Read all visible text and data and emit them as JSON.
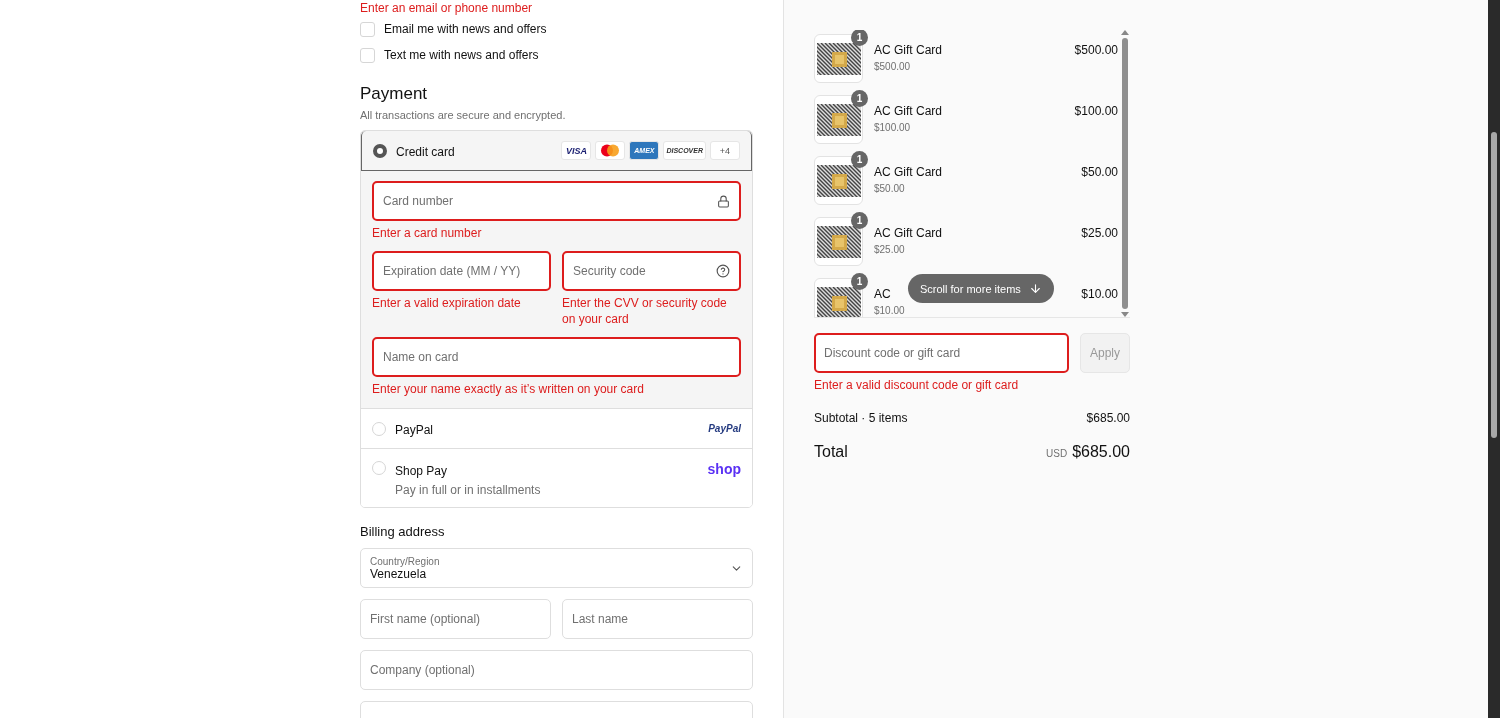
{
  "contact_error": "Enter an email or phone number",
  "marketing": [
    {
      "label": "Email me with news and offers",
      "checked": false
    },
    {
      "label": "Text me with news and offers",
      "checked": false
    }
  ],
  "payment": {
    "title": "Payment",
    "subtitle": "All transactions are secure and encrypted.",
    "methods": [
      {
        "kind": "card",
        "label": "Credit card",
        "selected": true,
        "brands": [
          {
            "kind": "visa",
            "label": "VISA"
          },
          {
            "kind": "mastercard"
          },
          {
            "kind": "amex",
            "label": "AMEX"
          },
          {
            "kind": "discover",
            "label": "DISCOVER"
          },
          {
            "kind": "more",
            "label": "+4"
          }
        ],
        "fields": [
          {
            "kind": "number",
            "placeholder": "Card number",
            "error": "Enter a card number"
          },
          {
            "kind": "expiry",
            "placeholder": "Expiration date (MM / YY)",
            "error": "Enter a valid expiration date"
          },
          {
            "kind": "cvv",
            "placeholder": "Security code",
            "error": "Enter the CVV or security code on your card"
          },
          {
            "kind": "name",
            "placeholder": "Name on card",
            "error": "Enter your name exactly as it’s written on your card"
          }
        ]
      },
      {
        "kind": "paypal",
        "label": "PayPal",
        "selected": false,
        "logo": "PayPal"
      },
      {
        "kind": "shoppay",
        "label": "Shop Pay",
        "selected": false,
        "logo": "shop",
        "note": "Pay in full or in installments"
      }
    ]
  },
  "billing": {
    "title": "Billing address",
    "country_label": "Country/Region",
    "country": "Venezuela",
    "fields": [
      {
        "placeholder": "First name (optional)"
      },
      {
        "placeholder": "Last name"
      },
      {
        "placeholder": "Company (optional)"
      }
    ]
  },
  "cart": {
    "items": [
      {
        "quantity": "1",
        "name": "AC Gift Card",
        "unit": "$500.00",
        "price": "$500.00"
      },
      {
        "quantity": "1",
        "name": "AC Gift Card",
        "unit": "$100.00",
        "price": "$100.00"
      },
      {
        "quantity": "1",
        "name": "AC Gift Card",
        "unit": "$50.00",
        "price": "$50.00"
      },
      {
        "quantity": "1",
        "name": "AC Gift Card",
        "unit": "$25.00",
        "price": "$25.00"
      },
      {
        "quantity": "1",
        "name": "AC",
        "unit": "$10.00",
        "price": "$10.00"
      }
    ],
    "scroll_hint": "Scroll for more items",
    "discount": {
      "placeholder": "Discount code or gift card",
      "error": "Enter a valid discount code or gift card",
      "button": "Apply"
    },
    "subtotal_label": "Subtotal · 5 items",
    "subtotal": "$685.00",
    "total_label": "Total",
    "currency": "USD",
    "total": "$685.00"
  }
}
